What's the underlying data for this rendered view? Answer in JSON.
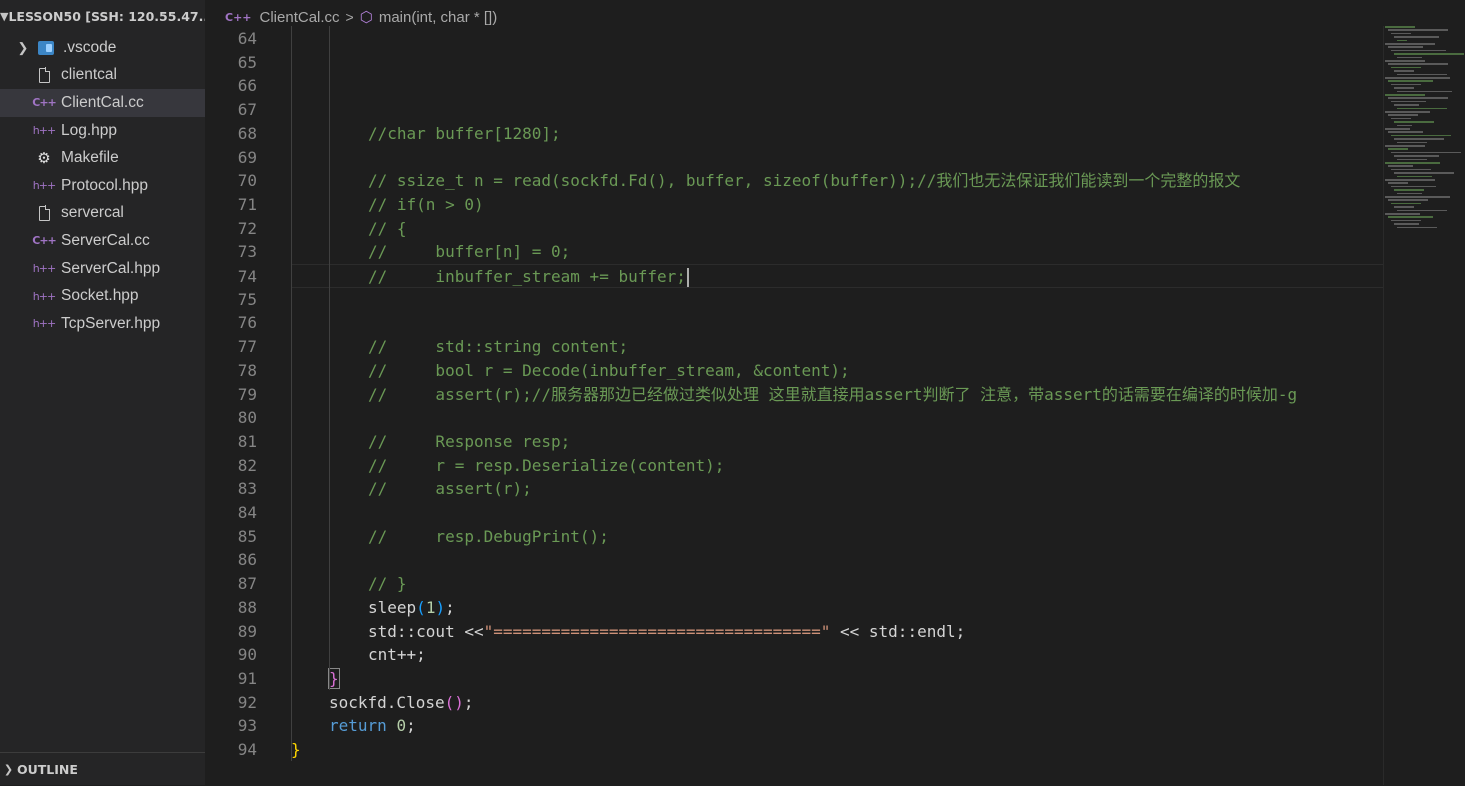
{
  "sidebar": {
    "title": "LESSON50 [SSH: 120.55.47...",
    "items": [
      {
        "label": ".vscode",
        "icon": "vscode-folder-icon",
        "type": "folder"
      },
      {
        "label": "clientcal",
        "icon": "file-icon",
        "type": "file"
      },
      {
        "label": "ClientCal.cc",
        "icon": "cpp-icon",
        "type": "file",
        "selected": true
      },
      {
        "label": "Log.hpp",
        "icon": "hpp-icon",
        "type": "file"
      },
      {
        "label": "Makefile",
        "icon": "makefile-icon",
        "type": "file"
      },
      {
        "label": "Protocol.hpp",
        "icon": "hpp-icon",
        "type": "file"
      },
      {
        "label": "servercal",
        "icon": "file-icon",
        "type": "file"
      },
      {
        "label": "ServerCal.cc",
        "icon": "cpp-icon",
        "type": "file"
      },
      {
        "label": "ServerCal.hpp",
        "icon": "hpp-icon",
        "type": "file"
      },
      {
        "label": "Socket.hpp",
        "icon": "hpp-icon",
        "type": "file"
      },
      {
        "label": "TcpServer.hpp",
        "icon": "hpp-icon",
        "type": "file"
      }
    ],
    "outline_label": "OUTLINE",
    "cpp_glyph": "C++",
    "hpp_glyph": "h++"
  },
  "breadcrumb": {
    "file": "ClientCal.cc",
    "separator": ">",
    "symbol": "main(int, char * [])"
  },
  "editor": {
    "lines": [
      {
        "n": "64"
      },
      {
        "n": "65"
      },
      {
        "n": "66"
      },
      {
        "n": "67"
      },
      {
        "n": "68",
        "code": "//char buffer[1280];"
      },
      {
        "n": "69"
      },
      {
        "n": "70",
        "code": "// ssize_t n = read(sockfd.Fd(), buffer, sizeof(buffer));//我们也无法保证我们能读到一个完整的报文"
      },
      {
        "n": "71",
        "code": "// if(n > 0)"
      },
      {
        "n": "72",
        "code": "// {"
      },
      {
        "n": "73",
        "code": "//     buffer[n] = 0;"
      },
      {
        "n": "74",
        "code": "//     inbuffer_stream += buffer;"
      },
      {
        "n": "75"
      },
      {
        "n": "76"
      },
      {
        "n": "77",
        "code": "//     std::string content;"
      },
      {
        "n": "78",
        "code": "//     bool r = Decode(inbuffer_stream, &content);"
      },
      {
        "n": "79",
        "code": "//     assert(r);//服务器那边已经做过类似处理 这里就直接用assert判断了 注意，带assert的话需要在编译的时候加-g"
      },
      {
        "n": "80"
      },
      {
        "n": "81",
        "code": "//     Response resp;"
      },
      {
        "n": "82",
        "code": "//     r = resp.Deserialize(content);"
      },
      {
        "n": "83",
        "code": "//     assert(r);"
      },
      {
        "n": "84"
      },
      {
        "n": "85",
        "code": "//     resp.DebugPrint();"
      },
      {
        "n": "86"
      },
      {
        "n": "87",
        "code": "// }"
      },
      {
        "n": "88",
        "code": "sleep(1);"
      },
      {
        "n": "89",
        "code": "std::cout <<\"==================================\" << std::endl;"
      },
      {
        "n": "90",
        "code": "cnt++;"
      },
      {
        "n": "91",
        "code": "}"
      },
      {
        "n": "92",
        "code": "sockfd.Close();"
      },
      {
        "n": "93",
        "code": "return 0;"
      },
      {
        "n": "94",
        "code": "}"
      }
    ],
    "current_line": "74"
  },
  "colors": {
    "comment": "#6a9955",
    "keyword": "#569cd6",
    "string": "#ce9178",
    "number": "#b5cea8",
    "default": "#d4d4d4",
    "line_number": "#858585",
    "sidebar_bg": "#252526",
    "editor_bg": "#1e1e1e",
    "selected_item_bg": "#37373d"
  }
}
